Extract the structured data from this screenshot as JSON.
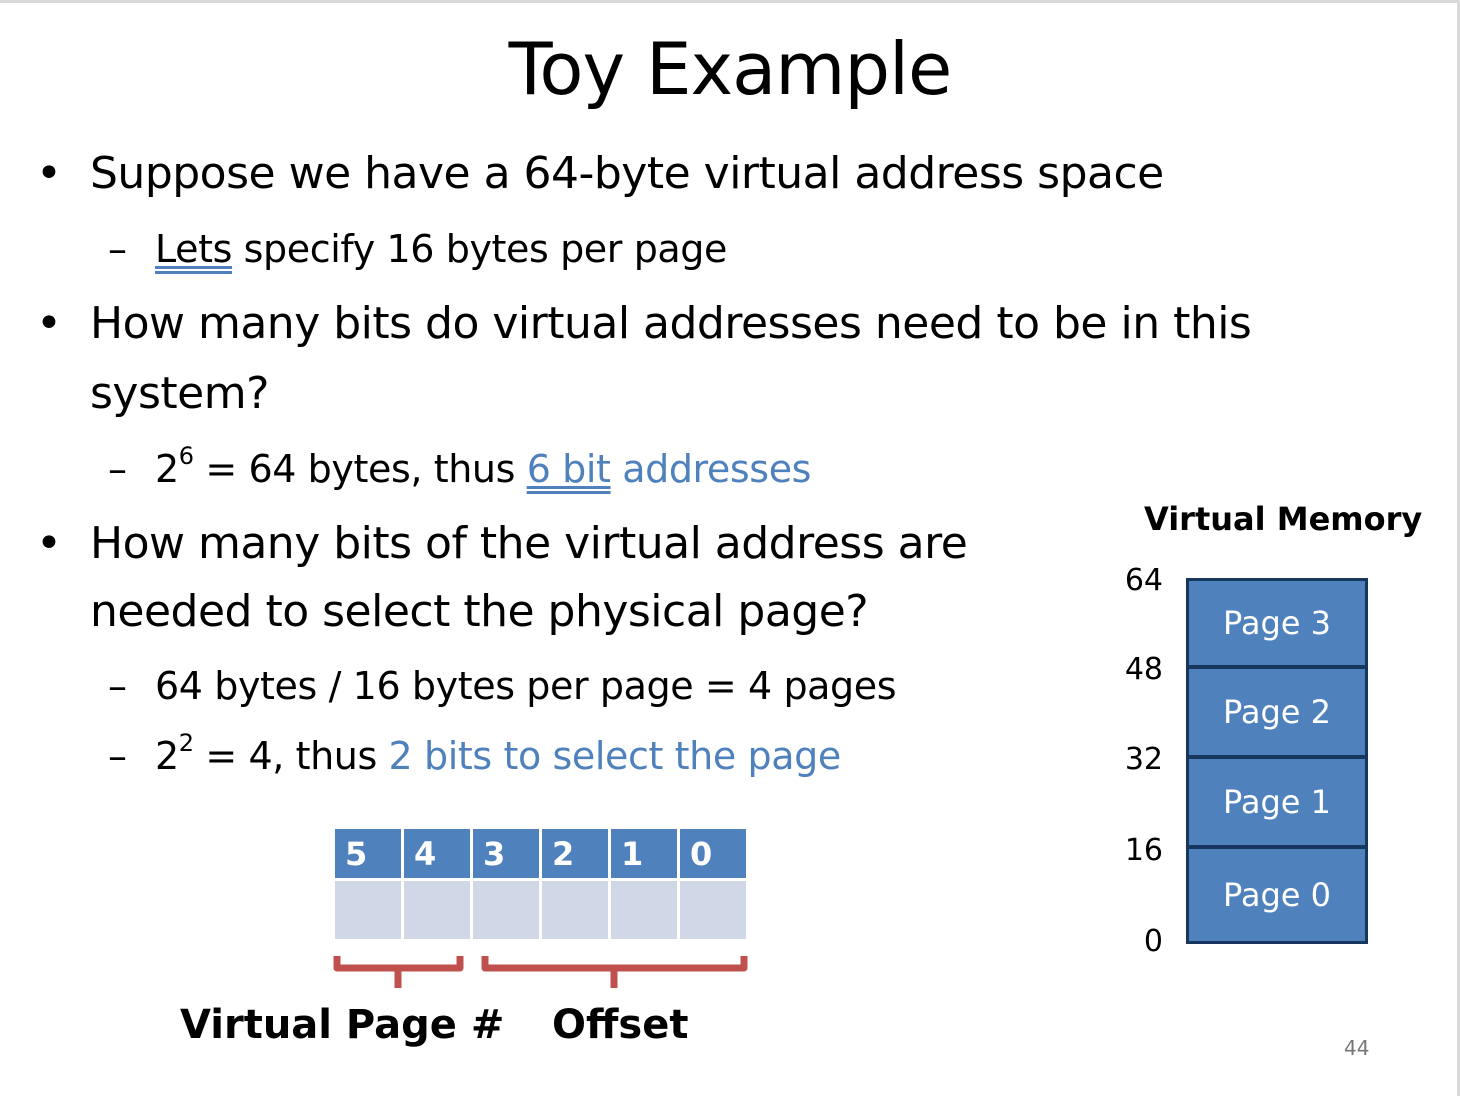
{
  "slide": {
    "title": "Toy Example",
    "page_number": "44"
  },
  "bullets": [
    {
      "text": "Suppose we have a 64-byte virtual address space",
      "subs": [
        {
          "part1": "Lets",
          "part2": " specify 16 bytes per page"
        }
      ]
    },
    {
      "line1": "How many bits do virtual addresses need to be in this",
      "line2": "system?",
      "subs": [
        {
          "base": "2",
          "exp": "6",
          "text": " = 64 bytes, thus ",
          "hl1": "6 bit",
          "hl2": " addresses"
        }
      ]
    },
    {
      "line1": "How many bits of the virtual address are",
      "line2": "needed to select the physical page?",
      "subs": [
        {
          "text": "64 bytes / 16 bytes per page = 4 pages"
        },
        {
          "base": "2",
          "exp": "2",
          "text": " = 4, thus ",
          "hl": "2 bits to select the page"
        }
      ]
    }
  ],
  "bit_diagram": {
    "bits": [
      "5",
      "4",
      "3",
      "2",
      "1",
      "0"
    ],
    "labels": {
      "vpn": "Virtual Page #",
      "offset": "Offset"
    },
    "colors": {
      "header": "#4f81bd",
      "cells": "#d0d8e8",
      "brace": "#c0504d"
    }
  },
  "virtual_memory": {
    "title": "Virtual Memory",
    "axis": [
      "64",
      "48",
      "32",
      "16",
      "0"
    ],
    "pages": [
      "Page 3",
      "Page 2",
      "Page 1",
      "Page 0"
    ],
    "colors": {
      "fill": "#4f81bd",
      "border": "#17375e"
    }
  },
  "bullet_marker": "•",
  "dash_marker": "–"
}
